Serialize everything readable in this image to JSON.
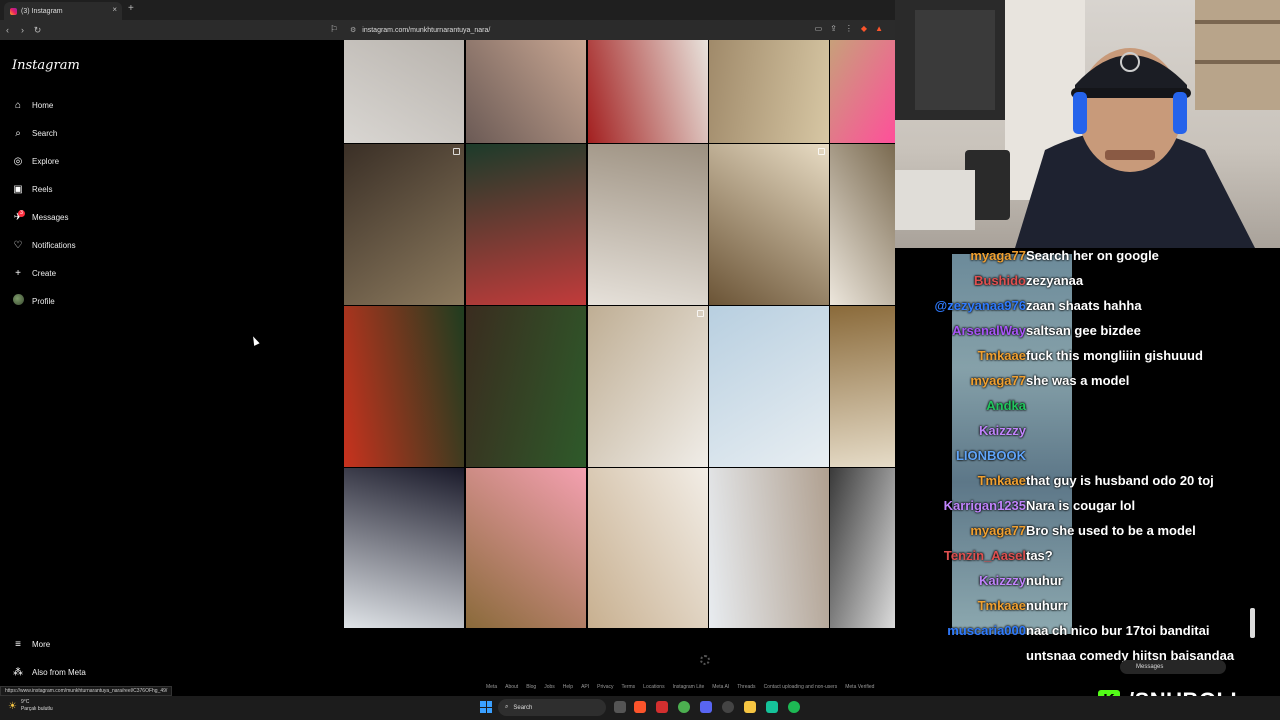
{
  "browser": {
    "tab_title": "(3) Instagram",
    "new_tab": "+",
    "tab_close": "×",
    "url": "instagram.com/munkhturnarantuya_nara/",
    "status_url": "https://www.instagram.com/munkhturnarantuya_nara/reel/C376OFhg_49/"
  },
  "sidebar": {
    "logo": "Instagram",
    "items": [
      {
        "label": "Home",
        "icon": "⌂",
        "name": "home"
      },
      {
        "label": "Search",
        "icon": "⌕",
        "name": "search"
      },
      {
        "label": "Explore",
        "icon": "◎",
        "name": "explore"
      },
      {
        "label": "Reels",
        "icon": "▣",
        "name": "reels"
      },
      {
        "label": "Messages",
        "icon": "✈",
        "name": "messages"
      },
      {
        "label": "Notifications",
        "icon": "♡",
        "name": "notifications"
      },
      {
        "label": "Create",
        "icon": "+",
        "name": "create"
      },
      {
        "label": "Profile",
        "icon": "",
        "name": "profile"
      }
    ],
    "messages_badge": "3",
    "more_label": "More",
    "meta_label": "Also from Meta"
  },
  "footer_links": [
    "Meta",
    "About",
    "Blog",
    "Jobs",
    "Help",
    "API",
    "Privacy",
    "Terms",
    "Locations",
    "Instagram Lite",
    "Meta AI",
    "Threads",
    "Contact uploading and non-users",
    "Meta Verified"
  ],
  "taskbar": {
    "weather_temp": "9°C",
    "weather_desc": "Parçalı bulutlu",
    "search_placeholder": "Search"
  },
  "chat": {
    "messages": [
      {
        "user": "myaga77",
        "text": "Search her on google",
        "color": "#f0a030"
      },
      {
        "user": "Bushido",
        "text": "zezyanaa",
        "color": "#e05050"
      },
      {
        "user": "@zezyanaa976",
        "text": "zaan shaats hahha",
        "color": "#2f7bff"
      },
      {
        "user": "ArsenalWay",
        "text": "saltsan gee bizdee",
        "color": "#a855f7"
      },
      {
        "user": "Tmkaae",
        "text": "fuck this mongliiin gishuuud",
        "color": "#f0a030"
      },
      {
        "user": "myaga77",
        "text": "she was a model",
        "color": "#f0a030"
      },
      {
        "user": "Andka",
        "text": "",
        "color": "#22c55e"
      },
      {
        "user": "Kaizzzy",
        "text": "",
        "color": "#c084fc"
      },
      {
        "user": "LIONBOOK",
        "text": "",
        "color": "#60a5fa"
      },
      {
        "user": "Tmkaae",
        "text": "that guy is husband odo 20 toj",
        "color": "#f0a030"
      },
      {
        "user": "Karrigan1235",
        "text": "Nara is cougar lol",
        "color": "#c084fc"
      },
      {
        "user": "myaga77",
        "text": "Bro she used to be a model",
        "color": "#f0a030"
      },
      {
        "user": "Tenzin_Aasel",
        "text": "tas?",
        "color": "#e05050"
      },
      {
        "user": "Kaizzzy",
        "text": "nuhur",
        "color": "#c084fc"
      },
      {
        "user": "Tmkaae",
        "text": "nuhurr",
        "color": "#f0a030"
      },
      {
        "user": "muscaria000",
        "text": "naa ch nico bur 17toi banditai",
        "color": "#2f7bff"
      },
      {
        "user": "",
        "text": "untsnaa comedy hiitsn baisandaa",
        "color": "#ffffff"
      }
    ],
    "messages_pill": "Messages",
    "brand": "/SNUBOLI",
    "brand_logo": "K"
  },
  "colors": {
    "kick_green": "#53fc18",
    "notification_red": "#ff3040",
    "background": "#000000"
  }
}
